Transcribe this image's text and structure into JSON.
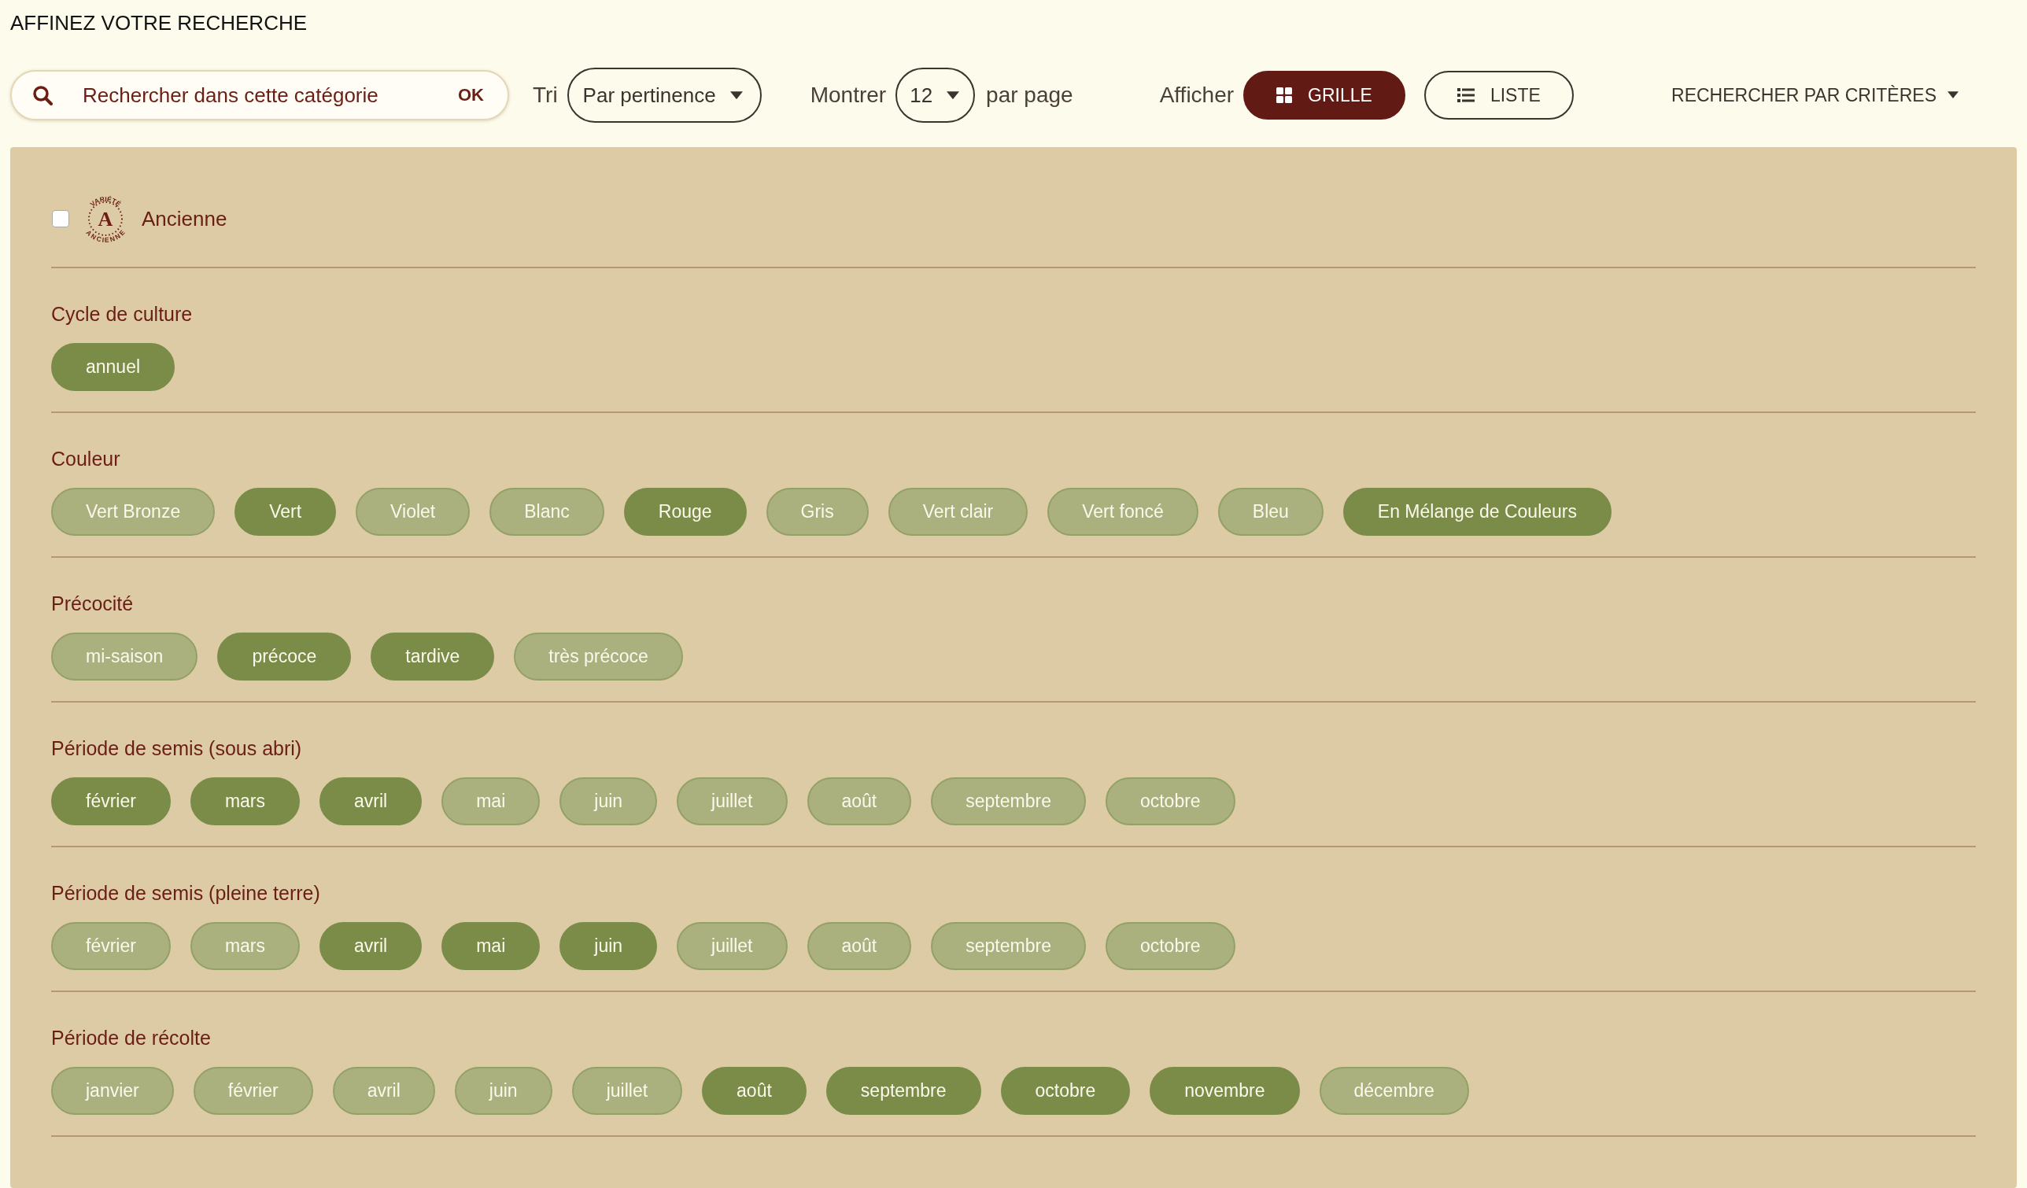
{
  "title": "AFFINEZ VOTRE RECHERCHE",
  "search": {
    "placeholder": "Rechercher dans cette catégorie",
    "submit": "OK"
  },
  "sort": {
    "label": "Tri",
    "value": "Par pertinence"
  },
  "per_page": {
    "label": "Montrer",
    "value": "12",
    "suffix": "par page"
  },
  "display": {
    "label": "Afficher",
    "options": [
      {
        "kind": "grid",
        "label": "GRILLE",
        "selected": true
      },
      {
        "kind": "list",
        "label": "LISTE",
        "selected": false
      }
    ]
  },
  "criteria_menu": "RECHERCHER PAR CRITÈRES",
  "heirloom": {
    "label": "Ancienne",
    "checked": false,
    "badge": {
      "top": "VARIÉTÉ",
      "letter": "A",
      "bottom": "ANCIENNE"
    }
  },
  "groups": [
    {
      "title": "Cycle de culture",
      "options": [
        {
          "label": "annuel",
          "selected": true
        }
      ]
    },
    {
      "title": "Couleur",
      "options": [
        {
          "label": "Vert Bronze",
          "selected": false
        },
        {
          "label": "Vert",
          "selected": true
        },
        {
          "label": "Violet",
          "selected": false
        },
        {
          "label": "Blanc",
          "selected": false
        },
        {
          "label": "Rouge",
          "selected": true
        },
        {
          "label": "Gris",
          "selected": false
        },
        {
          "label": "Vert clair",
          "selected": false
        },
        {
          "label": "Vert foncé",
          "selected": false
        },
        {
          "label": "Bleu",
          "selected": false
        },
        {
          "label": "En Mélange de Couleurs",
          "selected": true
        }
      ]
    },
    {
      "title": "Précocité",
      "options": [
        {
          "label": "mi-saison",
          "selected": false
        },
        {
          "label": "précoce",
          "selected": true
        },
        {
          "label": "tardive",
          "selected": true
        },
        {
          "label": "très précoce",
          "selected": false
        }
      ]
    },
    {
      "title": "Période de semis (sous abri)",
      "options": [
        {
          "label": "février",
          "selected": true
        },
        {
          "label": "mars",
          "selected": true
        },
        {
          "label": "avril",
          "selected": true
        },
        {
          "label": "mai",
          "selected": false
        },
        {
          "label": "juin",
          "selected": false
        },
        {
          "label": "juillet",
          "selected": false
        },
        {
          "label": "août",
          "selected": false
        },
        {
          "label": "septembre",
          "selected": false
        },
        {
          "label": "octobre",
          "selected": false
        }
      ]
    },
    {
      "title": "Période de semis (pleine terre)",
      "options": [
        {
          "label": "février",
          "selected": false
        },
        {
          "label": "mars",
          "selected": false
        },
        {
          "label": "avril",
          "selected": true
        },
        {
          "label": "mai",
          "selected": true
        },
        {
          "label": "juin",
          "selected": true
        },
        {
          "label": "juillet",
          "selected": false
        },
        {
          "label": "août",
          "selected": false
        },
        {
          "label": "septembre",
          "selected": false
        },
        {
          "label": "octobre",
          "selected": false
        }
      ]
    },
    {
      "title": "Période de récolte",
      "options": [
        {
          "label": "janvier",
          "selected": false
        },
        {
          "label": "février",
          "selected": false
        },
        {
          "label": "avril",
          "selected": false
        },
        {
          "label": "juin",
          "selected": false
        },
        {
          "label": "juillet",
          "selected": false
        },
        {
          "label": "août",
          "selected": true
        },
        {
          "label": "septembre",
          "selected": true
        },
        {
          "label": "octobre",
          "selected": true
        },
        {
          "label": "novembre",
          "selected": true
        },
        {
          "label": "décembre",
          "selected": false
        }
      ]
    }
  ]
}
